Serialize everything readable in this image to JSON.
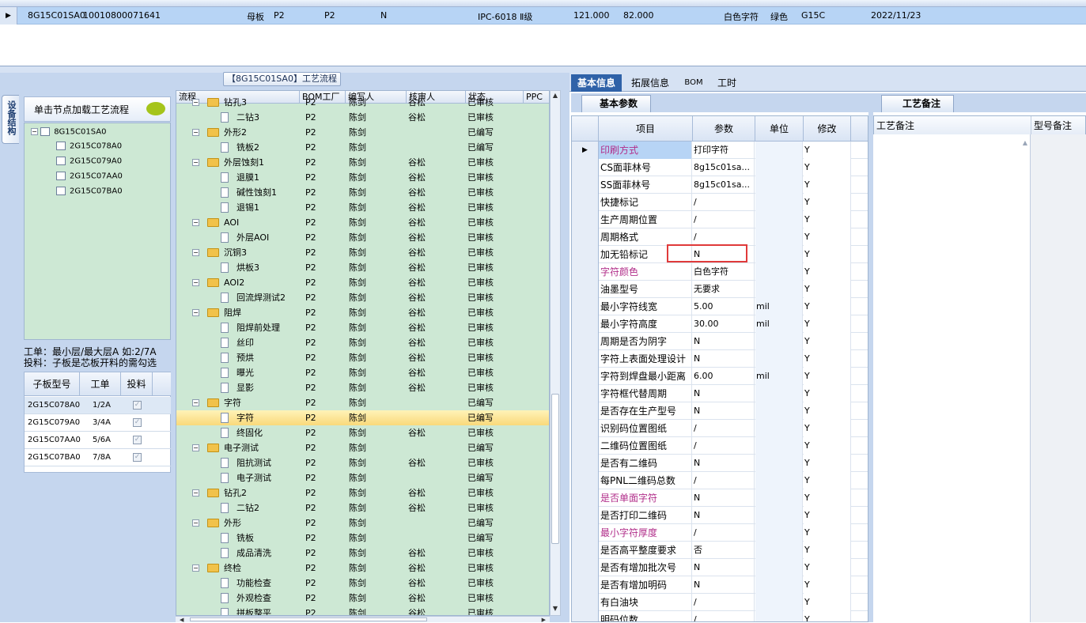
{
  "top_row": {
    "code": "8G15C01SA0",
    "number": "10010800071641",
    "board_type": "母板",
    "factory": "P2",
    "factory2": "P2",
    "flag": "N",
    "material": "IPC-6018 Ⅱ级",
    "size1": "121.000",
    "size2": "82.000",
    "char_color": "白色字符",
    "mask_color": "绿色",
    "model": "G15C",
    "date": "2022/11/23"
  },
  "left_panel": {
    "vertical_tab": "设备结构",
    "load_button": "单击节点加载工艺流程",
    "tree": [
      "8G15C01SA0",
      "2G15C078A0",
      "2G15C079A0",
      "2G15C07AA0",
      "2G15C07BA0"
    ],
    "info_line1": "工单：最小层/最大层A 如:2/7A",
    "info_line2": "投料：子板是芯板开料的需勾选",
    "sub_headers": [
      "子板型号",
      "工单",
      "投料"
    ],
    "sub_rows": [
      {
        "model": "2G15C078A0",
        "order": "1/2A"
      },
      {
        "model": "2G15C079A0",
        "order": "3/4A"
      },
      {
        "model": "2G15C07AA0",
        "order": "5/6A"
      },
      {
        "model": "2G15C07BA0",
        "order": "7/8A"
      }
    ]
  },
  "process": {
    "title": "【8G15C01SA0】工艺流程",
    "headers": [
      "流程",
      "BOM工厂",
      "编写人",
      "核审人",
      "状态",
      "PPC"
    ],
    "rows": [
      {
        "lvl": 0,
        "name": "钻孔3",
        "f": "P2",
        "w": "陈剑",
        "r": "谷松",
        "s": "已审核"
      },
      {
        "lvl": 1,
        "name": "二钻3",
        "f": "P2",
        "w": "陈剑",
        "r": "谷松",
        "s": "已审核"
      },
      {
        "lvl": 0,
        "name": "外形2",
        "f": "P2",
        "w": "陈剑",
        "r": "",
        "s": "已编写"
      },
      {
        "lvl": 1,
        "name": "铣板2",
        "f": "P2",
        "w": "陈剑",
        "r": "",
        "s": "已编写"
      },
      {
        "lvl": 0,
        "name": "外层蚀刻1",
        "f": "P2",
        "w": "陈剑",
        "r": "谷松",
        "s": "已审核"
      },
      {
        "lvl": 1,
        "name": "退膜1",
        "f": "P2",
        "w": "陈剑",
        "r": "谷松",
        "s": "已审核"
      },
      {
        "lvl": 1,
        "name": "碱性蚀刻1",
        "f": "P2",
        "w": "陈剑",
        "r": "谷松",
        "s": "已审核"
      },
      {
        "lvl": 1,
        "name": "退锡1",
        "f": "P2",
        "w": "陈剑",
        "r": "谷松",
        "s": "已审核"
      },
      {
        "lvl": 0,
        "name": "AOI",
        "f": "P2",
        "w": "陈剑",
        "r": "谷松",
        "s": "已审核"
      },
      {
        "lvl": 1,
        "name": "外层AOI",
        "f": "P2",
        "w": "陈剑",
        "r": "谷松",
        "s": "已审核"
      },
      {
        "lvl": 0,
        "name": "沉铜3",
        "f": "P2",
        "w": "陈剑",
        "r": "谷松",
        "s": "已审核"
      },
      {
        "lvl": 1,
        "name": "烘板3",
        "f": "P2",
        "w": "陈剑",
        "r": "谷松",
        "s": "已审核"
      },
      {
        "lvl": 0,
        "name": "AOI2",
        "f": "P2",
        "w": "陈剑",
        "r": "谷松",
        "s": "已审核"
      },
      {
        "lvl": 1,
        "name": "回流焊测试2",
        "f": "P2",
        "w": "陈剑",
        "r": "谷松",
        "s": "已审核"
      },
      {
        "lvl": 0,
        "name": "阻焊",
        "f": "P2",
        "w": "陈剑",
        "r": "谷松",
        "s": "已审核"
      },
      {
        "lvl": 1,
        "name": "阻焊前处理",
        "f": "P2",
        "w": "陈剑",
        "r": "谷松",
        "s": "已审核"
      },
      {
        "lvl": 1,
        "name": "丝印",
        "f": "P2",
        "w": "陈剑",
        "r": "谷松",
        "s": "已审核"
      },
      {
        "lvl": 1,
        "name": "预烘",
        "f": "P2",
        "w": "陈剑",
        "r": "谷松",
        "s": "已审核"
      },
      {
        "lvl": 1,
        "name": "曝光",
        "f": "P2",
        "w": "陈剑",
        "r": "谷松",
        "s": "已审核"
      },
      {
        "lvl": 1,
        "name": "显影",
        "f": "P2",
        "w": "陈剑",
        "r": "谷松",
        "s": "已审核"
      },
      {
        "lvl": 0,
        "name": "字符",
        "f": "P2",
        "w": "陈剑",
        "r": "",
        "s": "已编写"
      },
      {
        "lvl": 1,
        "name": "字符",
        "f": "P2",
        "w": "陈剑",
        "r": "",
        "s": "已编写",
        "sel": true
      },
      {
        "lvl": 1,
        "name": "终固化",
        "f": "P2",
        "w": "陈剑",
        "r": "谷松",
        "s": "已审核"
      },
      {
        "lvl": 0,
        "name": "电子测试",
        "f": "P2",
        "w": "陈剑",
        "r": "",
        "s": "已编写"
      },
      {
        "lvl": 1,
        "name": "阻抗测试",
        "f": "P2",
        "w": "陈剑",
        "r": "谷松",
        "s": "已审核"
      },
      {
        "lvl": 1,
        "name": "电子测试",
        "f": "P2",
        "w": "陈剑",
        "r": "",
        "s": "已编写"
      },
      {
        "lvl": 0,
        "name": "钻孔2",
        "f": "P2",
        "w": "陈剑",
        "r": "谷松",
        "s": "已审核"
      },
      {
        "lvl": 1,
        "name": "二钻2",
        "f": "P2",
        "w": "陈剑",
        "r": "谷松",
        "s": "已审核"
      },
      {
        "lvl": 0,
        "name": "外形",
        "f": "P2",
        "w": "陈剑",
        "r": "",
        "s": "已编写"
      },
      {
        "lvl": 1,
        "name": "铣板",
        "f": "P2",
        "w": "陈剑",
        "r": "",
        "s": "已编写"
      },
      {
        "lvl": 1,
        "name": "成品清洗",
        "f": "P2",
        "w": "陈剑",
        "r": "谷松",
        "s": "已审核"
      },
      {
        "lvl": 0,
        "name": "终检",
        "f": "P2",
        "w": "陈剑",
        "r": "谷松",
        "s": "已审核"
      },
      {
        "lvl": 1,
        "name": "功能检查",
        "f": "P2",
        "w": "陈剑",
        "r": "谷松",
        "s": "已审核"
      },
      {
        "lvl": 1,
        "name": "外观检查",
        "f": "P2",
        "w": "陈剑",
        "r": "谷松",
        "s": "已审核"
      },
      {
        "lvl": 1,
        "name": "拼板整平",
        "f": "P2",
        "w": "陈剑",
        "r": "谷松",
        "s": "已审核"
      }
    ]
  },
  "right_tabs": [
    "基本信息",
    "拓展信息",
    "BOM",
    "工时"
  ],
  "basic_params": {
    "tab": "基本参数",
    "headers": [
      "项目",
      "参数",
      "单位",
      "修改"
    ],
    "rows": [
      {
        "item": "印刷方式",
        "val": "打印字符",
        "unit": "",
        "mod": "Y",
        "hl": "mag",
        "current": true
      },
      {
        "item": "CS面菲林号",
        "val": "8g15c01sa...",
        "unit": "",
        "mod": "Y"
      },
      {
        "item": "SS面菲林号",
        "val": "8g15c01sa...",
        "unit": "",
        "mod": "Y"
      },
      {
        "item": "快捷标记",
        "val": "/",
        "unit": "",
        "mod": "Y"
      },
      {
        "item": "生产周期位置",
        "val": "/",
        "unit": "",
        "mod": "Y"
      },
      {
        "item": "周期格式",
        "val": "/",
        "unit": "",
        "mod": "Y"
      },
      {
        "item": "加无铅标记",
        "val": "N",
        "unit": "",
        "mod": "Y"
      },
      {
        "item": "字符颜色",
        "val": "白色字符",
        "unit": "",
        "mod": "Y",
        "hl": "mag"
      },
      {
        "item": "油墨型号",
        "val": "无要求",
        "unit": "",
        "mod": "Y"
      },
      {
        "item": "最小字符线宽",
        "val": "5.00",
        "unit": "mil",
        "mod": "Y"
      },
      {
        "item": "最小字符高度",
        "val": "30.00",
        "unit": "mil",
        "mod": "Y"
      },
      {
        "item": "周期是否为阴字",
        "val": "N",
        "unit": "",
        "mod": "Y"
      },
      {
        "item": "字符上表面处理设计",
        "val": "N",
        "unit": "",
        "mod": "Y"
      },
      {
        "item": "字符到焊盘最小距离",
        "val": "6.00",
        "unit": "mil",
        "mod": "Y"
      },
      {
        "item": "字符框代替周期",
        "val": "N",
        "unit": "",
        "mod": "Y"
      },
      {
        "item": "是否存在生产型号",
        "val": "N",
        "unit": "",
        "mod": "Y"
      },
      {
        "item": "识别码位置图纸",
        "val": "/",
        "unit": "",
        "mod": "Y"
      },
      {
        "item": "二维码位置图纸",
        "val": "/",
        "unit": "",
        "mod": "Y"
      },
      {
        "item": "是否有二维码",
        "val": "N",
        "unit": "",
        "mod": "Y"
      },
      {
        "item": "每PNL二维码总数",
        "val": "/",
        "unit": "",
        "mod": "Y"
      },
      {
        "item": "是否单面字符",
        "val": "N",
        "unit": "",
        "mod": "Y",
        "hl": "mag"
      },
      {
        "item": "是否打印二维码",
        "val": "N",
        "unit": "",
        "mod": "Y"
      },
      {
        "item": "最小字符厚度",
        "val": "/",
        "unit": "",
        "mod": "Y",
        "hl": "mag"
      },
      {
        "item": "是否高平整度要求",
        "val": "否",
        "unit": "",
        "mod": "Y"
      },
      {
        "item": "是否有增加批次号",
        "val": "N",
        "unit": "",
        "mod": "Y"
      },
      {
        "item": "是否有增加明码",
        "val": "N",
        "unit": "",
        "mod": "Y"
      },
      {
        "item": "有白油块",
        "val": "/",
        "unit": "",
        "mod": "Y"
      },
      {
        "item": "明码位数",
        "val": "/",
        "unit": "",
        "mod": "Y"
      }
    ]
  },
  "notes": {
    "tab": "工艺备注",
    "col1": "工艺备注",
    "col2": "型号备注"
  }
}
